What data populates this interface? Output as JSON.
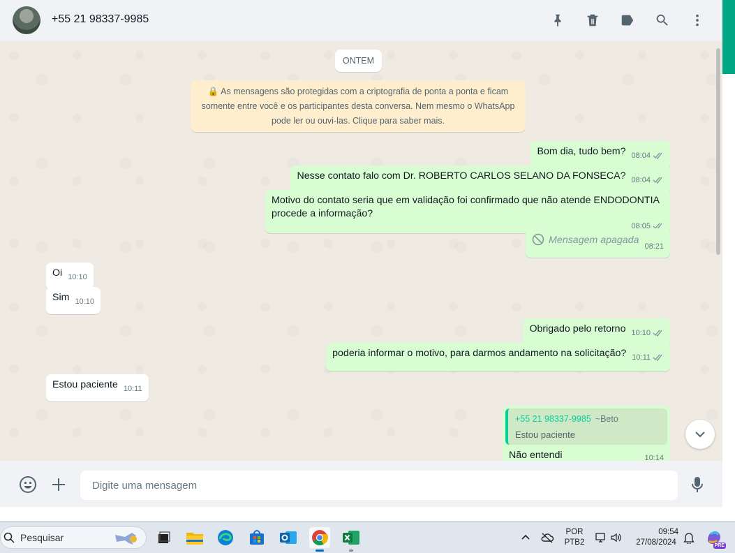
{
  "header": {
    "contact_name": "+55 21 98337-9985"
  },
  "chat": {
    "date_chip": "ONTEM",
    "encryption_notice": "🔒 As mensagens são protegidas com a criptografia de ponta a ponta e ficam somente entre você e os participantes desta conversa. Nem mesmo o WhatsApp pode ler ou ouvi-las. Clique para saber mais.",
    "messages": [
      {
        "direction": "out",
        "text": "Bom dia, tudo bem?",
        "time": "08:04"
      },
      {
        "direction": "out",
        "text": "Nesse contato falo com Dr. ROBERTO CARLOS SELANO DA FONSECA?",
        "time": "08:04"
      },
      {
        "direction": "out",
        "text": "Motivo do contato seria que em validação foi confirmado que não atende ENDODONTIA procede a informação?",
        "time": "08:05"
      },
      {
        "direction": "out",
        "text": "Mensagem apagada",
        "time": "08:21",
        "deleted": true
      },
      {
        "direction": "in",
        "text": "Oi",
        "time": "10:10"
      },
      {
        "direction": "in",
        "text": "Sim",
        "time": "10:10"
      },
      {
        "direction": "out",
        "text": "Obrigado pelo retorno",
        "time": "10:10"
      },
      {
        "direction": "out",
        "text": "poderia informar o motivo, para darmos andamento na solicitação?",
        "time": "10:11"
      },
      {
        "direction": "in",
        "text": "Estou paciente",
        "time": "10:11"
      },
      {
        "direction": "out",
        "text": "Não entendi",
        "time": "10:14",
        "quote": {
          "author": "+55 21 98337-9985",
          "push_name": "~Beto",
          "text": "Estou paciente"
        }
      }
    ]
  },
  "composer": {
    "placeholder": "Digite uma mensagem"
  },
  "taskbar": {
    "search_label": "Pesquisar",
    "language": "POR",
    "keyboard": "PTB2",
    "time": "09:54",
    "date": "27/08/2024",
    "copilot_badge": "PRE"
  },
  "colors": {
    "outgoing_bubble": "#d9fdd3",
    "incoming_bubble": "#ffffff",
    "accent": "#00a884",
    "read_tick": "#8696a0"
  }
}
